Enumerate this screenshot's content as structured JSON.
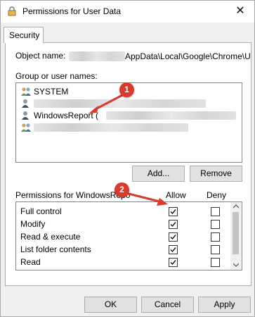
{
  "window": {
    "title": "Permissions for User Data",
    "close_glyph": "✕"
  },
  "tab": {
    "label": "Security"
  },
  "object": {
    "label": "Object name:",
    "path_visible": "AppData\\Local\\Google\\Chrome\\U"
  },
  "groups": {
    "label": "Group or user names:",
    "items": [
      {
        "label": "SYSTEM",
        "icon": "users-group-icon"
      },
      {
        "label": "",
        "icon": "user-icon"
      },
      {
        "label": "WindowsReport (",
        "icon": "user-icon"
      },
      {
        "label": "",
        "icon": "users-group-icon"
      }
    ]
  },
  "buttons": {
    "add": "Add...",
    "remove": "Remove",
    "ok": "OK",
    "cancel": "Cancel",
    "apply": "Apply"
  },
  "permissions": {
    "header": "Permissions for WindowsRepo",
    "allow_header": "Allow",
    "deny_header": "Deny",
    "rows": [
      {
        "label": "Full control",
        "allow": true,
        "deny": false
      },
      {
        "label": "Modify",
        "allow": true,
        "deny": false
      },
      {
        "label": "Read & execute",
        "allow": true,
        "deny": false
      },
      {
        "label": "List folder contents",
        "allow": true,
        "deny": false
      },
      {
        "label": "Read",
        "allow": true,
        "deny": false
      }
    ]
  },
  "annotations": [
    {
      "label": "1"
    },
    {
      "label": "2"
    }
  ],
  "colors": {
    "badge": "#d93a2b",
    "accent": "#0078d7"
  }
}
